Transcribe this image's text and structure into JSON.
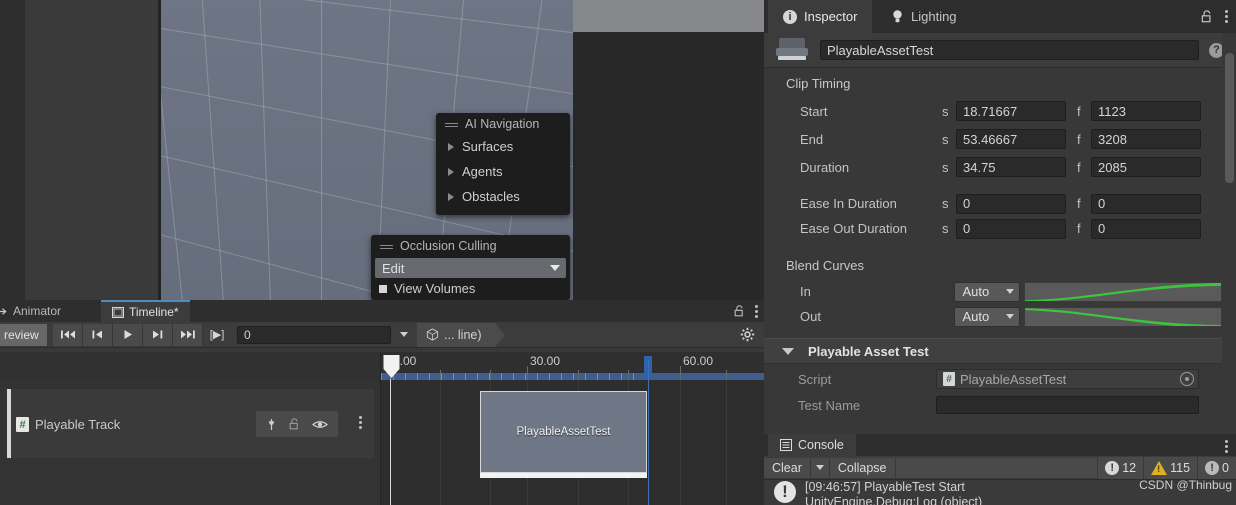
{
  "scene": {
    "overlays": [
      {
        "id": "ai-navigation",
        "title": "AI Navigation",
        "items": [
          "Surfaces",
          "Agents",
          "Obstacles"
        ]
      },
      {
        "id": "occlusion-culling",
        "title": "Occlusion Culling",
        "dropdown_value": "Edit",
        "checkbox_label": "View Volumes"
      }
    ]
  },
  "timeline": {
    "tabs": [
      {
        "label": "Animator",
        "icon": "animator-icon",
        "active": false
      },
      {
        "label": "Timeline*",
        "icon": "timeline-icon",
        "active": true
      }
    ],
    "lock_icon": "lock-icon",
    "menu_icon": "kebab-menu-icon",
    "toolbar": {
      "preview_label": "review",
      "buttons": [
        {
          "name": "go-to-start",
          "glyph": "⏮"
        },
        {
          "name": "previous-frame",
          "glyph": "⏴|"
        },
        {
          "name": "play",
          "glyph": "▶"
        },
        {
          "name": "next-frame",
          "glyph": "|▶"
        },
        {
          "name": "go-to-end",
          "glyph": "⏭"
        },
        {
          "name": "play-range",
          "glyph": "[▶]"
        }
      ],
      "frame_value": "0",
      "breadcrumb_label": "... line)",
      "settings_icon": "gear-icon"
    },
    "toolbar2": {
      "add_label": "+",
      "tools": [
        {
          "name": "mix-mode-tool",
          "active": true
        },
        {
          "name": "ripple-edit-tool",
          "active": false
        },
        {
          "name": "replace-edit-tool",
          "active": false
        },
        {
          "name": "marker-pin-tool",
          "active": false
        }
      ]
    },
    "ruler": {
      "labels": [
        "0.00",
        "30.00",
        "60.00"
      ],
      "label_positions": [
        391,
        528,
        681
      ],
      "playhead_frame": "0"
    },
    "track": {
      "name": "Playable Track",
      "icon": "script-track-icon",
      "buttons": [
        "pin-icon",
        "lock-icon",
        "eye-icon"
      ],
      "menu_icon": "kebab-menu-icon"
    },
    "clip": {
      "label": "PlayableAssetTest"
    }
  },
  "inspector": {
    "tabs": [
      {
        "label": "Inspector",
        "icon": "info-icon",
        "active": true
      },
      {
        "label": "Lighting",
        "icon": "light-bulb-icon",
        "active": false
      }
    ],
    "lock_icon": "lock-icon",
    "menu_icon": "kebab-menu-icon",
    "asset_name": "PlayableAssetTest",
    "help_icon": "help-icon",
    "clip_timing": {
      "title": "Clip Timing",
      "unit_seconds": "s",
      "unit_frames": "f",
      "rows": [
        {
          "label": "Start",
          "seconds": "18.71667",
          "frames": "1123"
        },
        {
          "label": "End",
          "seconds": "53.46667",
          "frames": "3208"
        },
        {
          "label": "Duration",
          "seconds": "34.75",
          "frames": "2085"
        },
        {
          "label": "Ease In Duration",
          "seconds": "0",
          "frames": "0"
        },
        {
          "label": "Ease Out Duration",
          "seconds": "0",
          "frames": "0"
        }
      ]
    },
    "blend_curves": {
      "title": "Blend Curves",
      "rows": [
        {
          "label": "In",
          "value": "Auto"
        },
        {
          "label": "Out",
          "value": "Auto"
        }
      ],
      "curve_color": "#3ec43e"
    },
    "component": {
      "title": "Playable Asset Test",
      "script_label": "Script",
      "script_value": "PlayableAssetTest",
      "test_name_label": "Test Name"
    }
  },
  "console": {
    "tab_label": "Console",
    "tab_icon": "console-icon",
    "menu_icon": "kebab-menu-icon",
    "clear_label": "Clear",
    "collapse_label": "Collapse",
    "counts": {
      "errors": "12",
      "warnings": "115",
      "infos": "0"
    },
    "entry": {
      "line1": "[09:46:57] PlayableTest Start",
      "line2": "UnityEngine.Debug:Log (object)"
    },
    "watermark": "CSDN @Thinbug"
  }
}
